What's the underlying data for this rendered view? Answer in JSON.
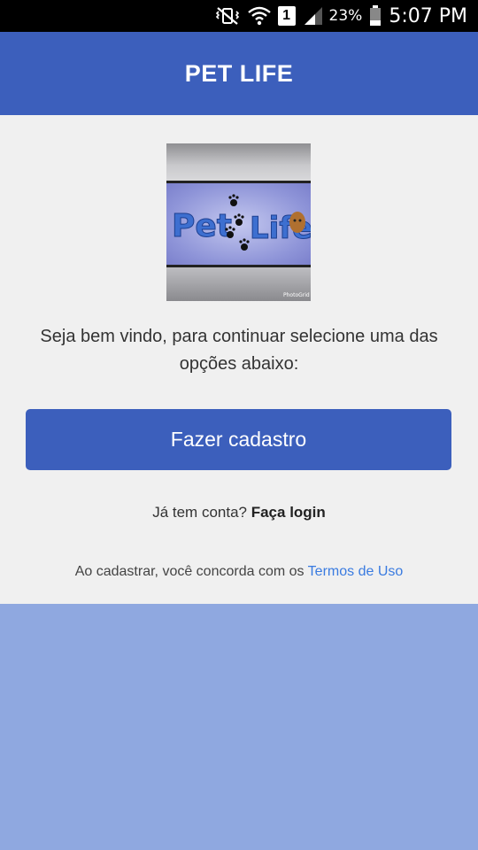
{
  "status_bar": {
    "battery_percent": "23%",
    "time": "5:07 PM",
    "sim_label": "1",
    "icons": [
      "mute-vibrate-icon",
      "wifi-icon",
      "sim-icon",
      "signal-icon",
      "battery-icon"
    ]
  },
  "app_bar": {
    "title": "PET LIFE"
  },
  "logo": {
    "text_pet": "Pet",
    "text_life": "Life",
    "watermark": "PhotoGrid"
  },
  "welcome_text": "Seja bem vindo, para continuar selecione uma das opções abaixo:",
  "signup_button": "Fazer cadastro",
  "login": {
    "prompt": "Já tem conta? ",
    "link": "Faça login"
  },
  "terms": {
    "prefix": "Ao cadastrar, você concorda com os ",
    "link": "Termos de Uso"
  },
  "colors": {
    "primary": "#3c5fbc",
    "background": "#f0f0f0",
    "lower_panel": "#8fa8e0",
    "link": "#3a7be0"
  }
}
